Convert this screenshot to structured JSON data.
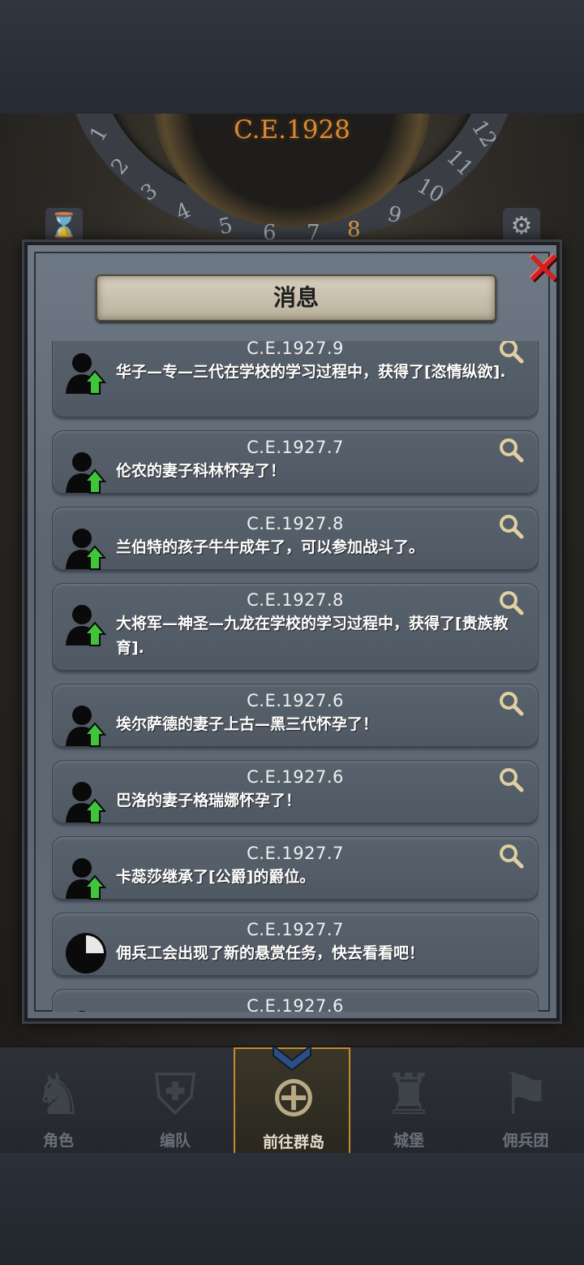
{
  "header": {
    "year": "C.E.1928"
  },
  "dial": {
    "numbers": [
      "1",
      "2",
      "3",
      "4",
      "5",
      "6",
      "7",
      "8",
      "9",
      "10",
      "11",
      "12"
    ],
    "current": "8"
  },
  "modal": {
    "title": "消息",
    "close_label": "✕",
    "messages": [
      {
        "date": "C.E.1927.9",
        "text": "华子—专—三代在学校的学习过程中，获得了[恣情纵欲].",
        "icon": "person-up-icon",
        "has_search": true
      },
      {
        "date": "C.E.1927.7",
        "text": "伦农的妻子科林怀孕了！",
        "icon": "person-up-icon",
        "has_search": true
      },
      {
        "date": "C.E.1927.8",
        "text": "兰伯特的孩子牛牛成年了，可以参加战斗了。",
        "icon": "person-up-icon",
        "has_search": true
      },
      {
        "date": "C.E.1927.8",
        "text": "大将军—神圣—九龙在学校的学习过程中，获得了[贵族教育].",
        "icon": "person-up-icon",
        "has_search": true
      },
      {
        "date": "C.E.1927.6",
        "text": "埃尔萨德的妻子上古—黑三代怀孕了！",
        "icon": "person-up-icon",
        "has_search": true
      },
      {
        "date": "C.E.1927.6",
        "text": "巴洛的妻子格瑞娜怀孕了！",
        "icon": "person-up-icon",
        "has_search": true
      },
      {
        "date": "C.E.1927.7",
        "text": "卡蕊莎继承了[公爵]的爵位。",
        "icon": "person-up-icon",
        "has_search": true
      },
      {
        "date": "C.E.1927.7",
        "text": "佣兵工会出现了新的悬赏任务，快去看看吧！",
        "icon": "clock-icon",
        "has_search": false
      },
      {
        "date": "C.E.1927.6",
        "text": "",
        "icon": "person-up-icon",
        "has_search": false
      }
    ]
  },
  "nav": {
    "items": [
      {
        "label": "角色",
        "glyph": "♞"
      },
      {
        "label": "编队",
        "glyph": "⛨"
      },
      {
        "label": "前往群岛",
        "glyph": "⊕"
      },
      {
        "label": "城堡",
        "glyph": "♜"
      },
      {
        "label": "佣兵团",
        "glyph": "⚑"
      }
    ],
    "active": "前往群岛"
  },
  "colors": {
    "year": "#d98a36",
    "accent": "#c68a2c",
    "close": "#d62020",
    "arrow": "#3fc53a"
  }
}
